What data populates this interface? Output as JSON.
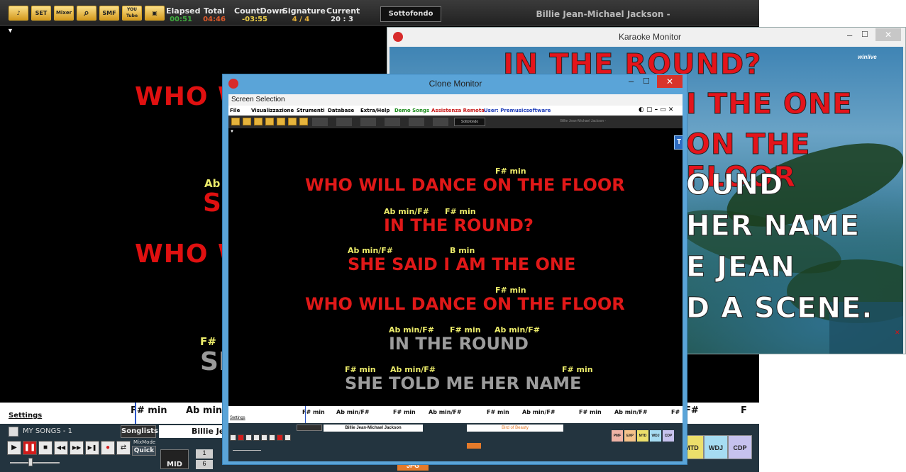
{
  "main": {
    "toolbar_icons": [
      "music-note",
      "set",
      "mixer",
      "search",
      "smf",
      "youtube",
      "screen"
    ],
    "toolbar_labels": {
      "set": "SET",
      "mixer": "Mixer",
      "smf": "SMF",
      "youtube": "YOU Tube"
    },
    "stats": [
      {
        "label": "Elapsed",
        "value": "00:51",
        "color": "#3fae3f"
      },
      {
        "label": "Total",
        "value": "04:46",
        "color": "#e05a2a"
      },
      {
        "label": "CountDown",
        "value": "-03:55",
        "color": "#f0d24a"
      },
      {
        "label": "Signature",
        "value": "4 / 4",
        "color": "#e6b13a"
      },
      {
        "label": "Current",
        "value": "20 : 3",
        "color": "#e8e8e8"
      }
    ],
    "sottofondo": "Sottofondo",
    "song_title": "Billie Jean-Michael Jackson -",
    "lyrics": {
      "line1": "WHO W",
      "chord2": "Ab",
      "line2": "S",
      "line3": "WHO W",
      "chord4": "F#",
      "line4": "SI"
    },
    "chordbar": [
      "F# min",
      "Ab min/",
      "F#",
      "F"
    ],
    "settings": "Settings",
    "playlist": "MY SONGS - 1",
    "songlists": "Songlists",
    "song_short": "Billie Je",
    "mixmode": "MixMode",
    "quick": "Quick",
    "mid": "MID",
    "numbers": [
      "1",
      "6"
    ],
    "jpg": "JPG",
    "format_buttons": [
      "MTD",
      "WDJ",
      "CDP"
    ]
  },
  "karaoke": {
    "title": "Karaoke Monitor",
    "logo": "winlive",
    "lines": [
      {
        "text": "IN THE ROUND?",
        "color": "red"
      },
      {
        "text": "I THE ONE",
        "color": "red"
      },
      {
        "text": "ON THE FLOOR",
        "color": "red"
      },
      {
        "text": "OUND",
        "color": "white"
      },
      {
        "text": "HER NAME",
        "color": "white"
      },
      {
        "text": "E JEAN",
        "color": "white"
      },
      {
        "text": "D A SCENE.",
        "color": "white"
      }
    ]
  },
  "clone": {
    "title": "Clone Monitor",
    "screen_selection": "Screen Selection",
    "menu": [
      "File",
      "Visualizzazione",
      "Strumenti",
      "Database",
      "Extra/Help",
      "Demo Songs",
      "Assistenza Remota",
      "User: Premusicsoftware"
    ],
    "menu_colors": {
      "Demo Songs": "#1a8a1a",
      "Assistenza Remota": "#c81818",
      "User: Premusicsoftware": "#1a3ab8"
    },
    "sottofondo": "Sottofondo",
    "song_title_small": "Billie Jean-Michael Jackson -",
    "t_badge": "T",
    "lyrics": [
      {
        "chords": [
          {
            "text": "F# min",
            "pos": 0.62
          }
        ],
        "text": "WHO WILL DANCE ON THE FLOOR",
        "style": "red"
      },
      {
        "chords": [
          {
            "text": "Ab min/F#",
            "pos": 0.0
          },
          {
            "text": "F# min",
            "pos": 0.43
          }
        ],
        "text": "IN THE ROUND?",
        "style": "red"
      },
      {
        "chords": [
          {
            "text": "Ab min/F#",
            "pos": 0.0
          },
          {
            "text": "B min",
            "pos": 0.57
          }
        ],
        "text": "SHE SAID I AM THE ONE",
        "style": "red"
      },
      {
        "chords": [
          {
            "text": "F# min",
            "pos": 0.62
          }
        ],
        "text": "WHO WILL DANCE ON THE FLOOR",
        "style": "red"
      },
      {
        "chords": [
          {
            "text": "Ab min/F#",
            "pos": 0.0
          },
          {
            "text": "F# min",
            "pos": 0.46
          },
          {
            "text": "Ab min/F#",
            "pos": 0.78
          }
        ],
        "text": "IN THE ROUND",
        "style": "gray"
      },
      {
        "chords": [
          {
            "text": "F# min",
            "pos": 0.0
          },
          {
            "text": "Ab min/F#",
            "pos": 0.2
          },
          {
            "text": "F# min",
            "pos": 0.98
          }
        ],
        "text": "SHE TOLD ME HER NAME",
        "style": "gray"
      }
    ],
    "chordbar": [
      "F# min",
      "Ab min/F#",
      "F# min",
      "Ab min/F#",
      "F# min",
      "Ab min/F#",
      "F# min",
      "Ab min/F#",
      "F#"
    ],
    "settings": "Settings",
    "song_field": "Billie Jean-Michael Jackson",
    "next_field": "Bird of Beauty",
    "format_buttons": [
      "PMF",
      "EXP",
      "MTD",
      "WDJ",
      "CDP"
    ]
  }
}
